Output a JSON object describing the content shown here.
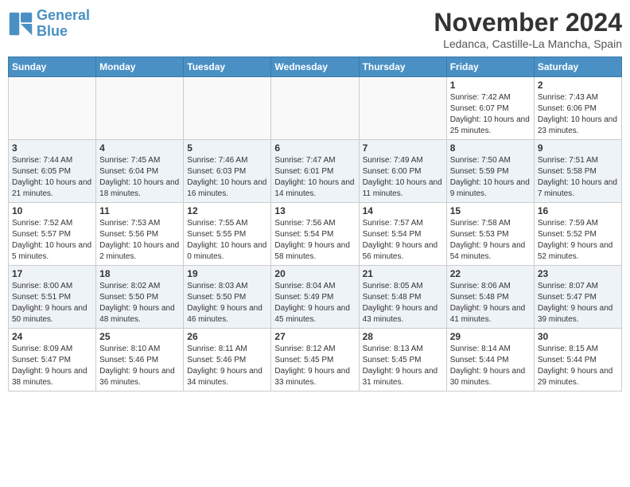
{
  "header": {
    "logo_line1": "General",
    "logo_line2": "Blue",
    "month": "November 2024",
    "location": "Ledanca, Castille-La Mancha, Spain"
  },
  "days_of_week": [
    "Sunday",
    "Monday",
    "Tuesday",
    "Wednesday",
    "Thursday",
    "Friday",
    "Saturday"
  ],
  "weeks": [
    [
      {
        "day": "",
        "info": "",
        "empty": true
      },
      {
        "day": "",
        "info": "",
        "empty": true
      },
      {
        "day": "",
        "info": "",
        "empty": true
      },
      {
        "day": "",
        "info": "",
        "empty": true
      },
      {
        "day": "",
        "info": "",
        "empty": true
      },
      {
        "day": "1",
        "info": "Sunrise: 7:42 AM\nSunset: 6:07 PM\nDaylight: 10 hours and 25 minutes."
      },
      {
        "day": "2",
        "info": "Sunrise: 7:43 AM\nSunset: 6:06 PM\nDaylight: 10 hours and 23 minutes."
      }
    ],
    [
      {
        "day": "3",
        "info": "Sunrise: 7:44 AM\nSunset: 6:05 PM\nDaylight: 10 hours and 21 minutes."
      },
      {
        "day": "4",
        "info": "Sunrise: 7:45 AM\nSunset: 6:04 PM\nDaylight: 10 hours and 18 minutes."
      },
      {
        "day": "5",
        "info": "Sunrise: 7:46 AM\nSunset: 6:03 PM\nDaylight: 10 hours and 16 minutes."
      },
      {
        "day": "6",
        "info": "Sunrise: 7:47 AM\nSunset: 6:01 PM\nDaylight: 10 hours and 14 minutes."
      },
      {
        "day": "7",
        "info": "Sunrise: 7:49 AM\nSunset: 6:00 PM\nDaylight: 10 hours and 11 minutes."
      },
      {
        "day": "8",
        "info": "Sunrise: 7:50 AM\nSunset: 5:59 PM\nDaylight: 10 hours and 9 minutes."
      },
      {
        "day": "9",
        "info": "Sunrise: 7:51 AM\nSunset: 5:58 PM\nDaylight: 10 hours and 7 minutes."
      }
    ],
    [
      {
        "day": "10",
        "info": "Sunrise: 7:52 AM\nSunset: 5:57 PM\nDaylight: 10 hours and 5 minutes."
      },
      {
        "day": "11",
        "info": "Sunrise: 7:53 AM\nSunset: 5:56 PM\nDaylight: 10 hours and 2 minutes."
      },
      {
        "day": "12",
        "info": "Sunrise: 7:55 AM\nSunset: 5:55 PM\nDaylight: 10 hours and 0 minutes."
      },
      {
        "day": "13",
        "info": "Sunrise: 7:56 AM\nSunset: 5:54 PM\nDaylight: 9 hours and 58 minutes."
      },
      {
        "day": "14",
        "info": "Sunrise: 7:57 AM\nSunset: 5:54 PM\nDaylight: 9 hours and 56 minutes."
      },
      {
        "day": "15",
        "info": "Sunrise: 7:58 AM\nSunset: 5:53 PM\nDaylight: 9 hours and 54 minutes."
      },
      {
        "day": "16",
        "info": "Sunrise: 7:59 AM\nSunset: 5:52 PM\nDaylight: 9 hours and 52 minutes."
      }
    ],
    [
      {
        "day": "17",
        "info": "Sunrise: 8:00 AM\nSunset: 5:51 PM\nDaylight: 9 hours and 50 minutes."
      },
      {
        "day": "18",
        "info": "Sunrise: 8:02 AM\nSunset: 5:50 PM\nDaylight: 9 hours and 48 minutes."
      },
      {
        "day": "19",
        "info": "Sunrise: 8:03 AM\nSunset: 5:50 PM\nDaylight: 9 hours and 46 minutes."
      },
      {
        "day": "20",
        "info": "Sunrise: 8:04 AM\nSunset: 5:49 PM\nDaylight: 9 hours and 45 minutes."
      },
      {
        "day": "21",
        "info": "Sunrise: 8:05 AM\nSunset: 5:48 PM\nDaylight: 9 hours and 43 minutes."
      },
      {
        "day": "22",
        "info": "Sunrise: 8:06 AM\nSunset: 5:48 PM\nDaylight: 9 hours and 41 minutes."
      },
      {
        "day": "23",
        "info": "Sunrise: 8:07 AM\nSunset: 5:47 PM\nDaylight: 9 hours and 39 minutes."
      }
    ],
    [
      {
        "day": "24",
        "info": "Sunrise: 8:09 AM\nSunset: 5:47 PM\nDaylight: 9 hours and 38 minutes."
      },
      {
        "day": "25",
        "info": "Sunrise: 8:10 AM\nSunset: 5:46 PM\nDaylight: 9 hours and 36 minutes."
      },
      {
        "day": "26",
        "info": "Sunrise: 8:11 AM\nSunset: 5:46 PM\nDaylight: 9 hours and 34 minutes."
      },
      {
        "day": "27",
        "info": "Sunrise: 8:12 AM\nSunset: 5:45 PM\nDaylight: 9 hours and 33 minutes."
      },
      {
        "day": "28",
        "info": "Sunrise: 8:13 AM\nSunset: 5:45 PM\nDaylight: 9 hours and 31 minutes."
      },
      {
        "day": "29",
        "info": "Sunrise: 8:14 AM\nSunset: 5:44 PM\nDaylight: 9 hours and 30 minutes."
      },
      {
        "day": "30",
        "info": "Sunrise: 8:15 AM\nSunset: 5:44 PM\nDaylight: 9 hours and 29 minutes."
      }
    ]
  ]
}
